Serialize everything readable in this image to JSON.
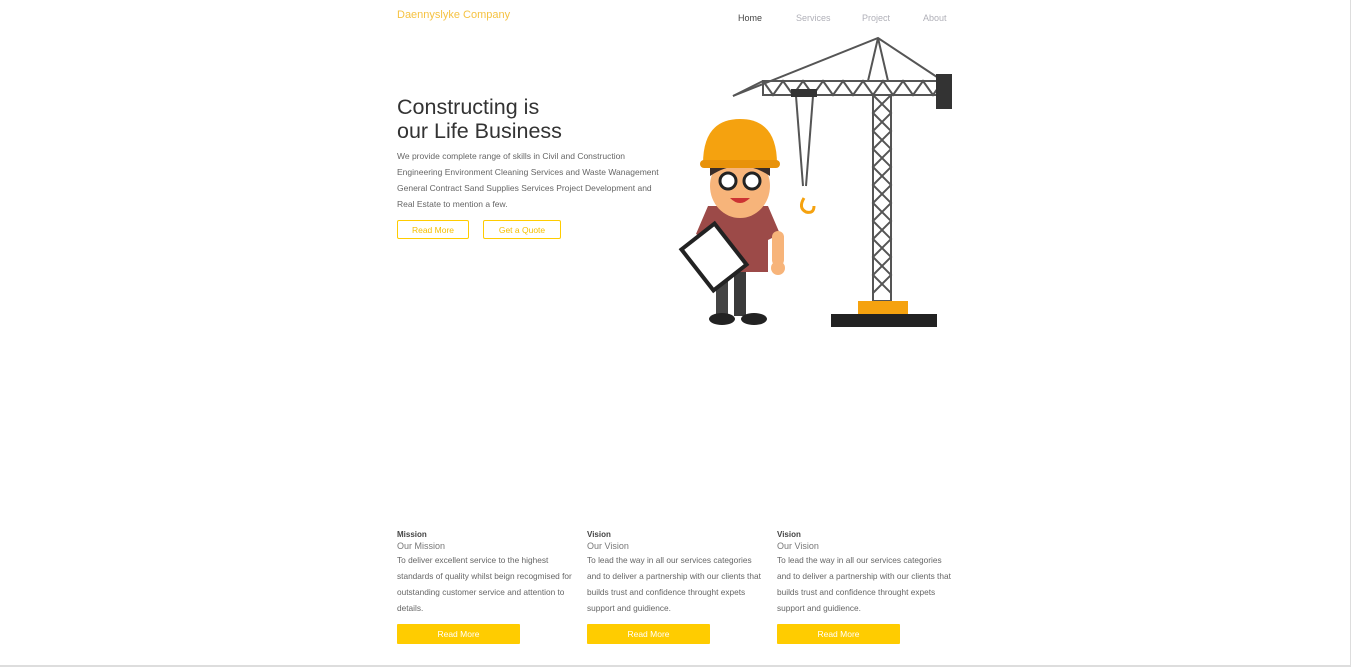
{
  "header": {
    "brand": "Daennyslyke Company",
    "nav": [
      "Home",
      "Services",
      "Project",
      "About"
    ]
  },
  "hero": {
    "title_line1": "Constructing is",
    "title_line2": "our Life Business",
    "description": "We provide complete range of skills in Civil and Construction Engineering Environment Cleaning Services and Waste Wanagement General Contract Sand Supplies Services Project Development and Real Estate to mention a few.",
    "read_more": "Read More",
    "get_quote": "Get a Quote"
  },
  "cards": [
    {
      "heading": "Mission",
      "subtitle": "Our Mission",
      "text": "To deliver excellent service to the highest standards of quality whilst beign recogmised for outstanding customer service and attention to details.",
      "button": "Read More"
    },
    {
      "heading": "Vision",
      "subtitle": "Our Vision",
      "text": "To lead the way in all our services categories and to deliver a partnership with our clients that builds trust and confidence throught expets support and guidience.",
      "button": "Read More"
    },
    {
      "heading": "Vision",
      "subtitle": "Our Vision",
      "text": "To lead the way in all our services categories and to deliver a partnership with our clients that builds trust and confidence throught expets support and guidience.",
      "button": "Read More"
    }
  ],
  "colors": {
    "accent": "#ffcc00",
    "brand": "#f5c242"
  }
}
